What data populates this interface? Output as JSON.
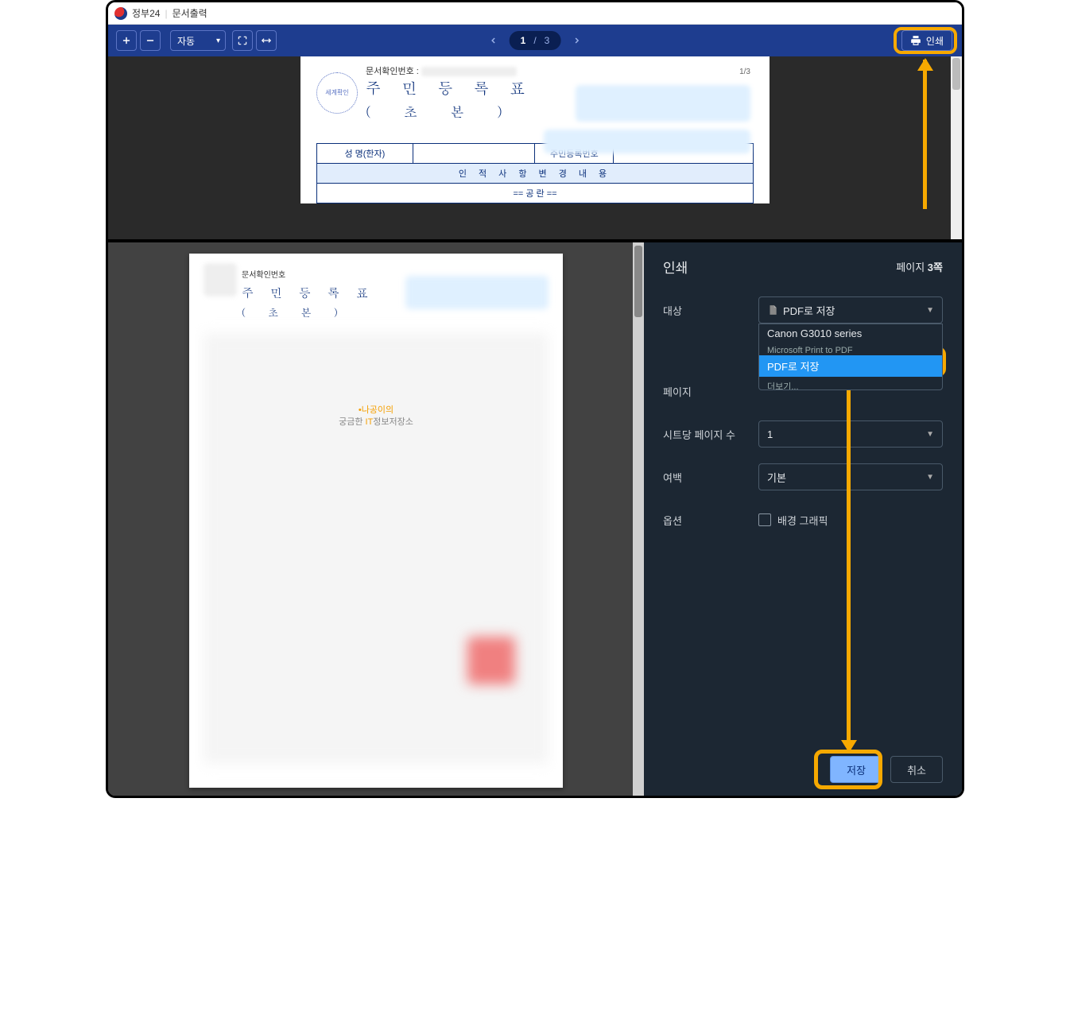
{
  "titlebar": {
    "site": "정부24",
    "page": "문서출력"
  },
  "toolbar": {
    "zoom_mode": "자동",
    "current_page": "1",
    "page_sep": "/",
    "total_pages": "3",
    "print_label": "인쇄"
  },
  "document": {
    "doc_num_label": "문서확인번호 :",
    "page_indicator": "1/3",
    "title": "주 민 등 록 표",
    "subtitle": "( 초   본 )",
    "col_name": "성 명(한자)",
    "col_rrn": "주민등록번호",
    "section_label": "인   적   사   항   변   경   내   용",
    "blank_row": "==      공         란      =="
  },
  "preview": {
    "doc_num_label": "문서확인번호",
    "title": "주 민 등 록 표",
    "subtitle": "( 초   본 )",
    "watermark_line1": "나공이의",
    "watermark_line2_a": "궁금한 ",
    "watermark_line2_b": "IT",
    "watermark_line2_c": "정보저장소"
  },
  "dialog": {
    "title": "인쇄",
    "sheets_prefix": "페이지 ",
    "sheets_count": "3쪽",
    "labels": {
      "destination": "대상",
      "pages": "페이지",
      "per_sheet": "시트당 페이지 수",
      "margins": "여백",
      "options": "옵션"
    },
    "destination_value": "PDF로 저장",
    "destination_options": {
      "canon": "Canon G3010 series",
      "ms": "Microsoft Print to PDF",
      "pdf": "PDF로 저장",
      "more": "더보기..."
    },
    "per_sheet_value": "1",
    "margins_value": "기본",
    "bg_graphics": "배경 그래픽",
    "save_btn": "저장",
    "cancel_btn": "취소"
  }
}
